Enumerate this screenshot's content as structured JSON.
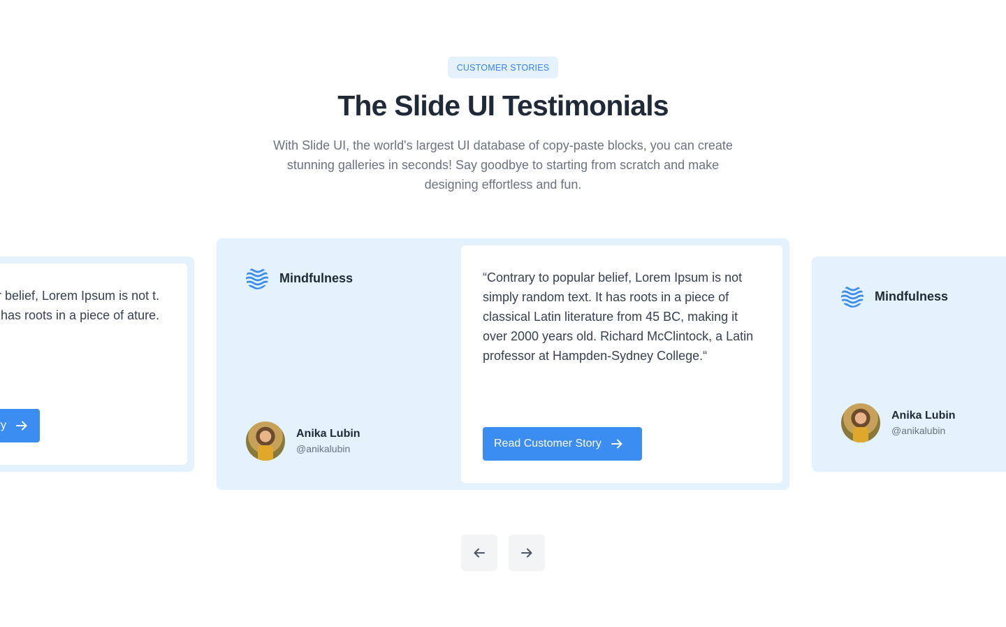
{
  "header": {
    "badge": "CUSTOMER STORIES",
    "title": "The Slide UI Testimonials",
    "description": "With Slide UI, the world's largest UI database of copy-paste blocks, you can create stunning galleries in seconds! Say goodbye to starting from scratch and make designing effortless and fun."
  },
  "slides": {
    "left": {
      "quote": "ar belief, Lorem Ipsum is not t. It has roots in a piece of ature.",
      "button_label": "ory"
    },
    "center": {
      "brand": "Mindfulness",
      "quote": "“Contrary to popular belief, Lorem Ipsum is not simply random text. It has roots in a piece of classical Latin literature from 45 BC, making it over 2000 years old. Richard McClintock, a Latin professor at Hampden-Sydney College.“",
      "author_name": "Anika Lubin",
      "author_handle": "@anikalubin",
      "button_label": "Read Customer Story"
    },
    "right": {
      "brand": "Mindfulness",
      "author_name": "Anika Lubin",
      "author_handle": "@anikalubin"
    }
  },
  "controls": {
    "prev_icon": "arrow-left-icon",
    "next_icon": "arrow-right-icon"
  },
  "colors": {
    "accent": "#3b8df1",
    "card_background": "#e3f2fd",
    "badge_text": "#3b82f6"
  }
}
